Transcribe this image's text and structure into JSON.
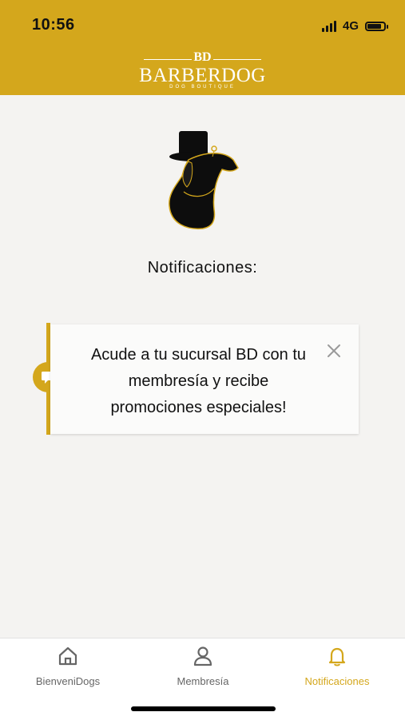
{
  "status_bar": {
    "time": "10:56",
    "network": "4G",
    "battery_level": 0.85
  },
  "header": {
    "logo_monogram": "BD",
    "logo_text": "BARBERDOG",
    "logo_subtext": "DOG BOUTIQUE",
    "background_color": "#d4a71c"
  },
  "page": {
    "title": "Notificaciones:"
  },
  "notifications": [
    {
      "message": "Acude a tu sucursal BD con tu membresía y recibe promociones especiales!",
      "icon": "chat-bubble-icon"
    }
  ],
  "tabbar": {
    "tabs": [
      {
        "label": "BienveniDogs",
        "icon": "home-icon",
        "active": false
      },
      {
        "label": "Membresía",
        "icon": "user-icon",
        "active": false
      },
      {
        "label": "Notificaciones",
        "icon": "bell-icon",
        "active": true
      }
    ],
    "active_color": "#d4a71c"
  }
}
